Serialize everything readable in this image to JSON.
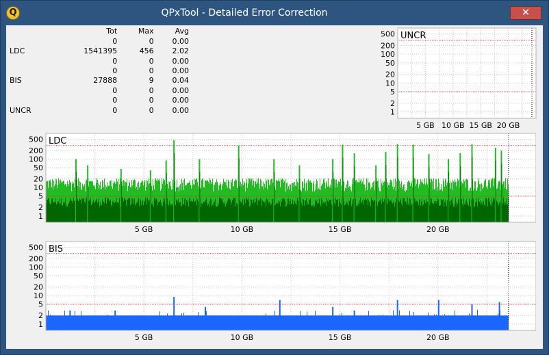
{
  "window": {
    "title": "QPxTool - Detailed Error Correction",
    "icon_letter": "Q",
    "close_glyph": "✕"
  },
  "stats": {
    "headers": [
      "",
      "Tot",
      "Max",
      "Avg"
    ],
    "rows": [
      [
        "",
        "0",
        "0",
        "0.00"
      ],
      [
        "LDC",
        "1541395",
        "456",
        "2.02"
      ],
      [
        "",
        "0",
        "0",
        "0.00"
      ],
      [
        "",
        "0",
        "0",
        "0.00"
      ],
      [
        "BIS",
        "27888",
        "9",
        "0.04"
      ],
      [
        "",
        "0",
        "0",
        "0.00"
      ],
      [
        "",
        "0",
        "0",
        "0.00"
      ],
      [
        "UNCR",
        "0",
        "0",
        "0.00"
      ]
    ]
  },
  "colors": {
    "title_bar": "#2e557f",
    "window_bg": "#f0f0f0",
    "ldc_light": "#22bb22",
    "ldc_dark": "#006600",
    "bis": "#1a66ff",
    "limit_line": "#cc3333",
    "end_marker": "#000000"
  },
  "chart_data": [
    {
      "type": "bar",
      "title": "UNCR",
      "y_scale": "log",
      "ylim": [
        0.6,
        800
      ],
      "xlim": [
        0,
        25
      ],
      "y_ticks": [
        "500",
        "200",
        "100",
        "50",
        "20",
        "10",
        "5",
        "2",
        "1"
      ],
      "x_ticks": [
        "5 GB",
        "10 GB",
        "15 GB",
        "20 GB"
      ],
      "limit_lines": [
        300,
        5
      ],
      "values": []
    },
    {
      "type": "bar",
      "title": "LDC",
      "y_scale": "log",
      "ylim": [
        0.6,
        800
      ],
      "xlim": [
        0,
        25
      ],
      "disc_end_gb": 23.6,
      "y_ticks": [
        "500",
        "200",
        "100",
        "50",
        "20",
        "10",
        "5",
        "2",
        "1"
      ],
      "x_ticks": [
        "5 GB",
        "10 GB",
        "15 GB",
        "20 GB"
      ],
      "limit_lines": [
        300,
        5
      ],
      "peaks": [
        {
          "x": 1.5,
          "y": 100
        },
        {
          "x": 2.1,
          "y": 60
        },
        {
          "x": 3.8,
          "y": 45
        },
        {
          "x": 5.3,
          "y": 40
        },
        {
          "x": 6.1,
          "y": 90
        },
        {
          "x": 6.5,
          "y": 456
        },
        {
          "x": 7.8,
          "y": 100
        },
        {
          "x": 9.8,
          "y": 300
        },
        {
          "x": 11.6,
          "y": 100
        },
        {
          "x": 12.9,
          "y": 60
        },
        {
          "x": 14.6,
          "y": 100
        },
        {
          "x": 15.1,
          "y": 320
        },
        {
          "x": 15.7,
          "y": 160
        },
        {
          "x": 16.8,
          "y": 60
        },
        {
          "x": 17.3,
          "y": 180
        },
        {
          "x": 17.9,
          "y": 330
        },
        {
          "x": 18.7,
          "y": 320
        },
        {
          "x": 19.5,
          "y": 150
        },
        {
          "x": 20.5,
          "y": 100
        },
        {
          "x": 21.1,
          "y": 160
        },
        {
          "x": 21.7,
          "y": 330
        },
        {
          "x": 22.9,
          "y": 250
        },
        {
          "x": 23.2,
          "y": 200
        }
      ],
      "base_light": 12,
      "base_dark": 3
    },
    {
      "type": "bar",
      "title": "BIS",
      "y_scale": "log",
      "ylim": [
        0.6,
        800
      ],
      "xlim": [
        0,
        25
      ],
      "disc_end_gb": 23.6,
      "y_ticks": [
        "500",
        "200",
        "100",
        "50",
        "20",
        "10",
        "5",
        "2",
        "1"
      ],
      "x_ticks": [
        "5 GB",
        "10 GB",
        "15 GB",
        "20 GB"
      ],
      "limit_lines": [
        300,
        5
      ],
      "peaks": [
        {
          "x": 1.2,
          "y": 3
        },
        {
          "x": 3.5,
          "y": 3
        },
        {
          "x": 6.5,
          "y": 9
        },
        {
          "x": 8.1,
          "y": 4
        },
        {
          "x": 11.9,
          "y": 7
        },
        {
          "x": 14.6,
          "y": 4
        },
        {
          "x": 15.7,
          "y": 3
        },
        {
          "x": 17.9,
          "y": 7
        },
        {
          "x": 20.0,
          "y": 7
        },
        {
          "x": 21.7,
          "y": 5
        },
        {
          "x": 23.1,
          "y": 6
        }
      ],
      "base": 2
    }
  ]
}
